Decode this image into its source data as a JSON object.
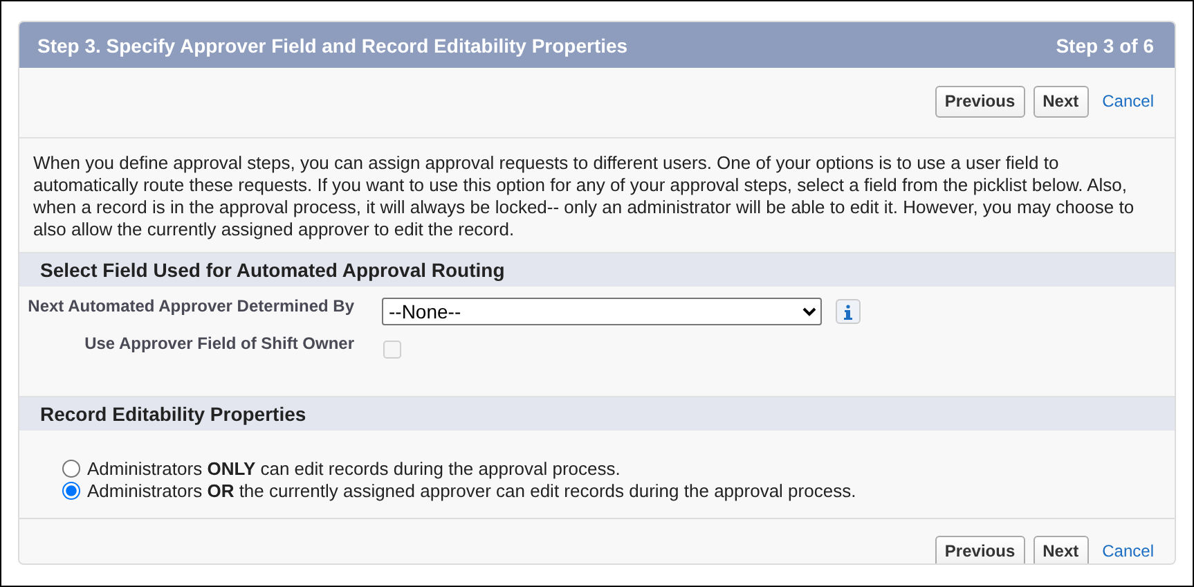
{
  "header": {
    "title": "Step 3. Specify Approver Field and Record Editability Properties",
    "step": "Step 3 of 6"
  },
  "top_buttons": {
    "previous": "Previous",
    "next": "Next",
    "cancel": "Cancel"
  },
  "description": "When you define approval steps, you can assign approval requests to different users. One of your options is to use a user field to automatically route these requests. If you want to use this option for any of your approval steps, select a field from the picklist below. Also, when a record is in the approval process, it will always be locked-- only an administrator will be able to edit it. However, you may choose to also allow the currently assigned approver to edit the record.",
  "routing_section": {
    "title": "Select Field Used for Automated Approval Routing",
    "approver_field": {
      "label": "Next Automated Approver Determined By",
      "value": "--None--"
    },
    "shift_owner": {
      "label": "Use Approver Field of Shift Owner",
      "checked": false,
      "disabled": true
    }
  },
  "editability_section": {
    "title": "Record Editability Properties",
    "options": [
      {
        "label": "Administrators **ONLY** can edit records during the approval process.",
        "selected": false
      },
      {
        "label": "Administrators **OR** the currently assigned approver can edit records during the approval process.",
        "selected": true
      }
    ]
  },
  "bottom_buttons": {
    "previous": "Previous",
    "next": "Next",
    "cancel": "Cancel"
  }
}
